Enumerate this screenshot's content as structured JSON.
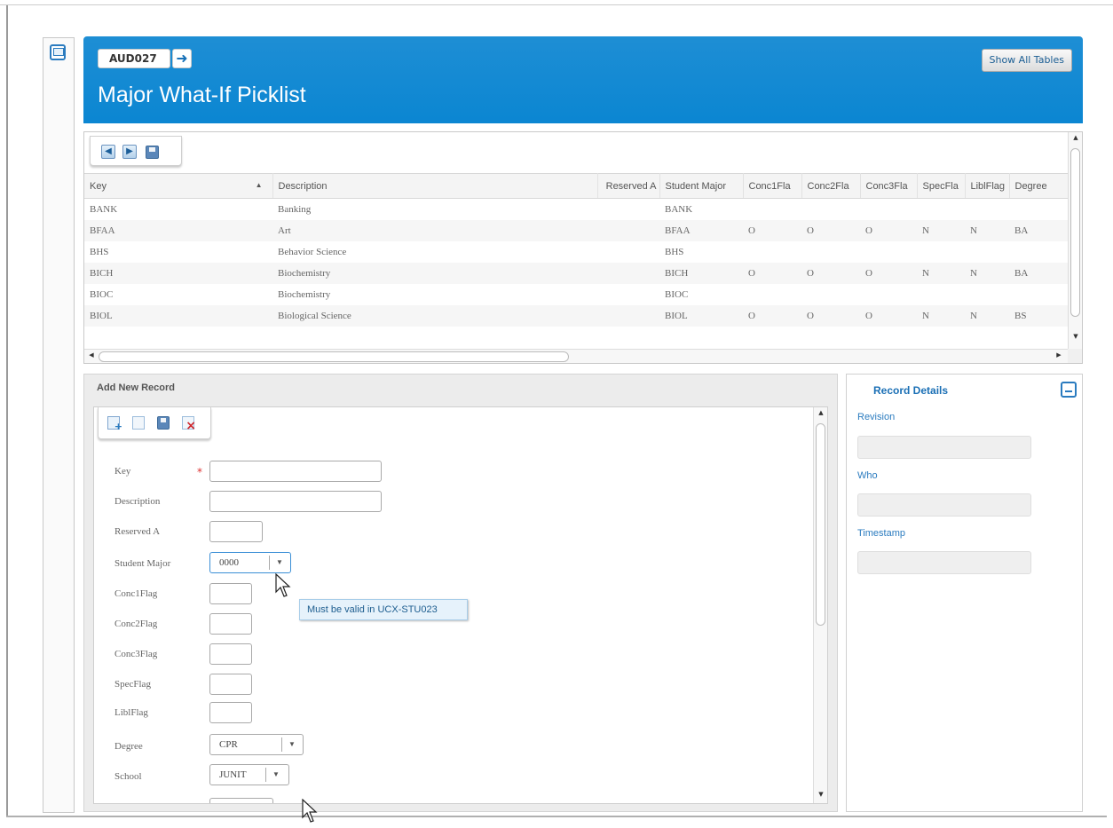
{
  "header": {
    "record_code": "AUD027",
    "title": "Major What-If Picklist",
    "show_all_tables_label": "Show All Tables"
  },
  "grid": {
    "columns": [
      "Key",
      "Description",
      "Reserved A",
      "Student Major",
      "Conc1Fla",
      "Conc2Fla",
      "Conc3Fla",
      "SpecFla",
      "LiblFlag",
      "Degree"
    ],
    "rows": [
      [
        "BANK",
        "Banking",
        "",
        "BANK",
        "",
        "",
        "",
        "",
        "",
        ""
      ],
      [
        "BFAA",
        "Art",
        "",
        "BFAA",
        "O",
        "O",
        "O",
        "N",
        "N",
        "BA"
      ],
      [
        "BHS",
        "Behavior Science",
        "",
        "BHS",
        "",
        "",
        "",
        "",
        "",
        ""
      ],
      [
        "BICH",
        "Biochemistry",
        "",
        "BICH",
        "O",
        "O",
        "O",
        "N",
        "N",
        "BA"
      ],
      [
        "BIOC",
        "Biochemistry",
        "",
        "BIOC",
        "",
        "",
        "",
        "",
        "",
        ""
      ],
      [
        "BIOL",
        "Biological Science",
        "",
        "BIOL",
        "O",
        "O",
        "O",
        "N",
        "N",
        "BS"
      ]
    ]
  },
  "form": {
    "title": "Add New Record",
    "fields": {
      "key": "Key",
      "description": "Description",
      "reserved_a": "Reserved A",
      "student_major": "Student Major",
      "conc1flag": "Conc1Flag",
      "conc2flag": "Conc2Flag",
      "conc3flag": "Conc3Flag",
      "specflag": "SpecFlag",
      "liblflag": "LiblFlag",
      "degree": "Degree",
      "school": "School"
    },
    "values": {
      "student_major": "0000",
      "degree": "CPR",
      "school": "JUNIT"
    },
    "tooltip": "Must be valid in UCX-STU023"
  },
  "details": {
    "title": "Record Details",
    "revision_label": "Revision",
    "who_label": "Who",
    "timestamp_label": "Timestamp"
  },
  "icons": {
    "rail": "window-icon",
    "nav_prev": "arrow-left-icon",
    "nav_next": "arrow-right-icon",
    "save": "floppy-disk-icon",
    "new": "new-record-icon",
    "copy": "copy-icon",
    "delete": "delete-icon",
    "collapse": "minimize-icon"
  },
  "colors": {
    "header_blue": "#0b86d2",
    "accent_blue": "#2a7bbf",
    "required_red": "#dd3333"
  }
}
